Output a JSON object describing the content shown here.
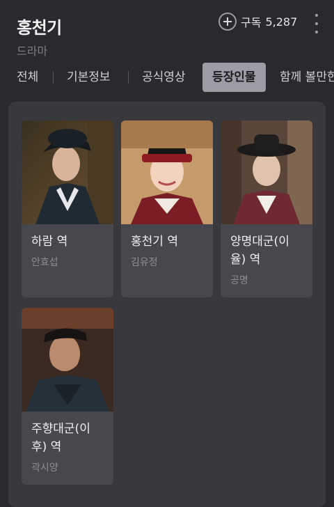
{
  "header": {
    "title": "홍천기",
    "subtitle": "드라마",
    "subscribe_label": "구독",
    "subscribe_count": "5,287"
  },
  "tabs": [
    {
      "label": "전체"
    },
    {
      "label": "기본정보"
    },
    {
      "label": "공식영상"
    },
    {
      "label": "등장인물",
      "active": true
    },
    {
      "label": "함께 볼만한"
    }
  ],
  "cast": [
    {
      "role": "하람 역",
      "actor": "안효섭"
    },
    {
      "role": "홍천기 역",
      "actor": "김유정"
    },
    {
      "role": "양명대군(이율) 역",
      "actor": "공명"
    },
    {
      "role": "주향대군(이후) 역",
      "actor": "곽시양"
    }
  ],
  "colors": {
    "background": "#2a2a2e",
    "panel": "#38383d",
    "card": "#47474d",
    "active_tab": "#9b9ca4"
  }
}
